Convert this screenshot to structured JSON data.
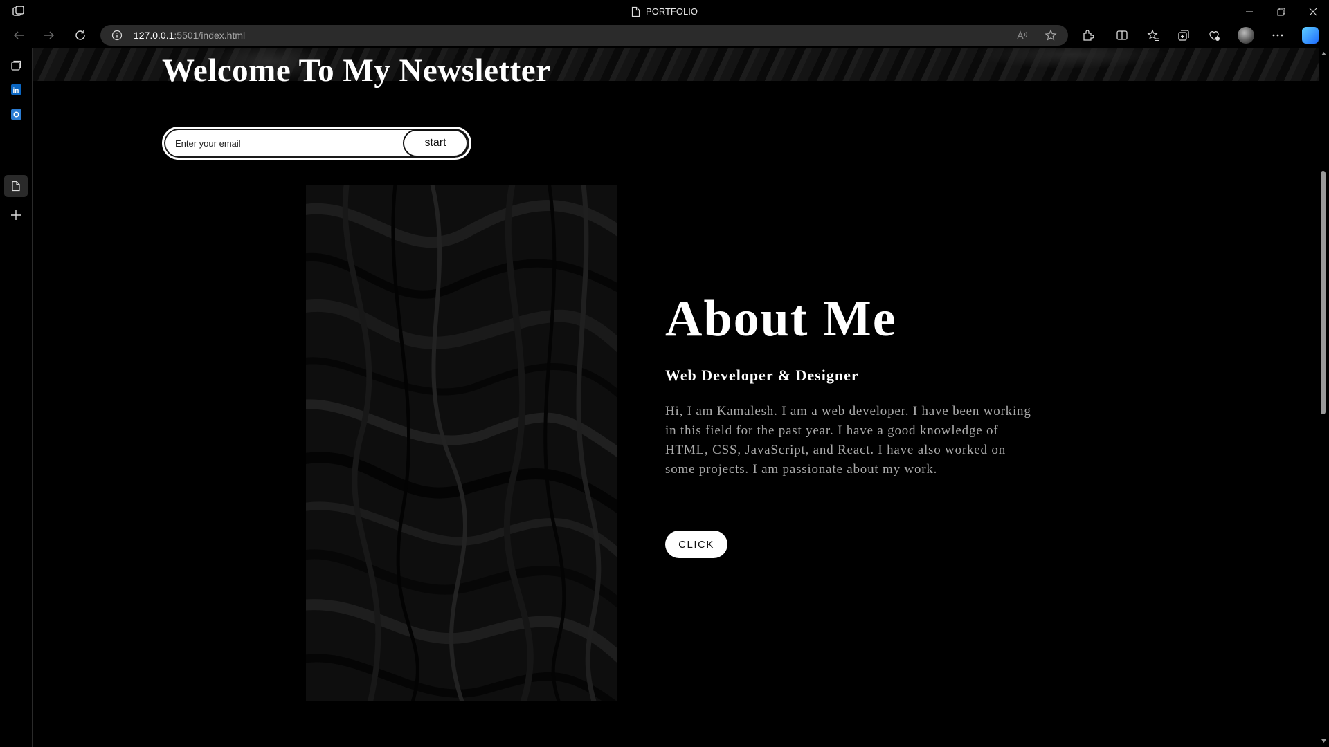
{
  "window": {
    "title": "PORTFOLIO"
  },
  "browser": {
    "address_host": "127.0.0.1",
    "address_path": ":5501/index.html"
  },
  "page": {
    "newsletter": {
      "title": "Welcome To My Newsletter",
      "email_placeholder": "Enter your email",
      "submit_label": "start"
    },
    "about": {
      "title": "About Me",
      "subtitle": "Web Developer & Designer",
      "body": "Hi, I am Kamalesh. I am a web developer. I have been working in this field for the past year. I have a good knowledge of HTML, CSS, JavaScript, and React. I have also worked on some projects. I am passionate about my work.",
      "button_label": "CLICK"
    }
  },
  "colors": {
    "page_background": "#000000",
    "text_primary": "#ffffff",
    "text_body": "#a9a9a9",
    "button_background": "#ffffff"
  }
}
